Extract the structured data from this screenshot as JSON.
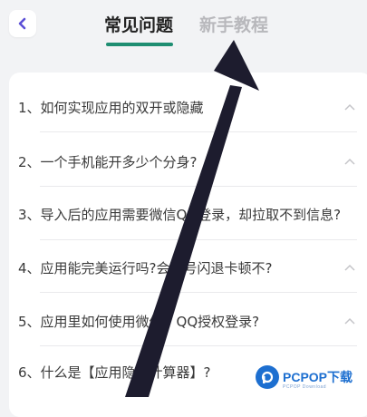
{
  "header": {
    "tabs": [
      {
        "label": "常见问题",
        "active": true
      },
      {
        "label": "新手教程",
        "active": false
      }
    ],
    "accent_color": "#1f8e72"
  },
  "faq": {
    "items": [
      {
        "label": "1、如何实现应用的双开或隐藏"
      },
      {
        "label": "2、一个手机能开多少个分身?"
      },
      {
        "label": "3、导入后的应用需要微信QQ登录，却拉取不到信息?"
      },
      {
        "label": "4、应用能完美运行吗?会封号闪退卡顿不?"
      },
      {
        "label": "5、应用里如何使用微信、QQ授权登录?"
      },
      {
        "label": "6、什么是【应用隐藏计算器】?"
      }
    ]
  },
  "watermark": {
    "brand": "PCPOP",
    "cn": "下载",
    "sub": "PCPOP Download"
  }
}
